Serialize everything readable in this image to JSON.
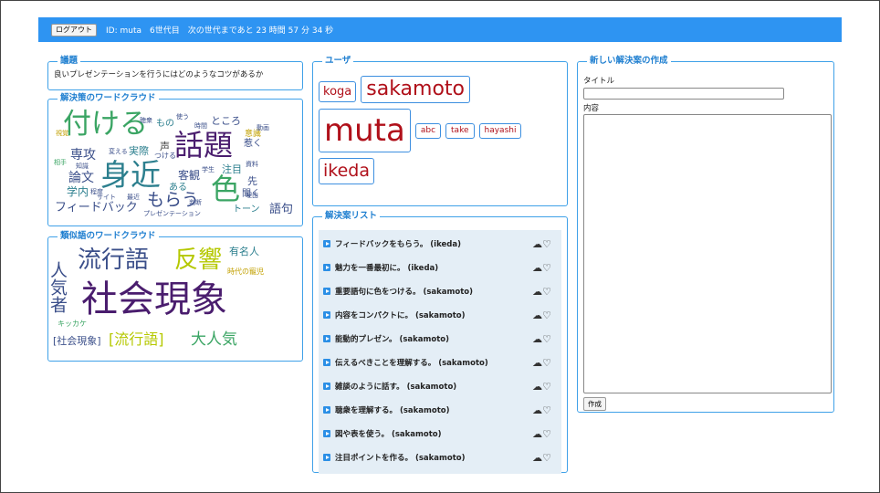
{
  "topbar": {
    "logout_label": "ログアウト",
    "info": "ID: muta　6世代目　次の世代まであと 23 時間 57 分 34 秒",
    "color": "#2e94f2"
  },
  "theme": {
    "legend": "議題",
    "text": "良いプレゼンテーションを行うにはどのようなコツがあるか"
  },
  "solution_cloud": {
    "legend": "解決策のワードクラウド",
    "words": [
      "付ける",
      "話題",
      "身近",
      "色",
      "もらう",
      "フィードバック",
      "専攻",
      "論文",
      "学内",
      "客観",
      "注目",
      "語句",
      "トーン",
      "先",
      "聞く",
      "声",
      "実際",
      "もの",
      "ところ",
      "惹く",
      "つける",
      "意識",
      "ある",
      "聴衆",
      "使う",
      "時間",
      "動画",
      "変える",
      "最近",
      "サイト",
      "プレゼンテーション",
      "判断",
      "資料",
      "理由",
      "学生",
      "程度",
      "知識",
      "視覚",
      "相手"
    ]
  },
  "similar_cloud": {
    "legend": "類似語のワードクラウド",
    "words": [
      "流行語",
      "反響",
      "有名人",
      "人気者",
      "時代の寵児",
      "社会現象",
      "キッカケ",
      "[社会現象]",
      "[流行語]",
      "大人気"
    ]
  },
  "users": {
    "legend": "ユーザ",
    "items": [
      "koga",
      "sakamoto",
      "muta",
      "abc",
      "take",
      "hayashi",
      "ikeda"
    ]
  },
  "solutions": {
    "legend": "解決案リスト",
    "icons": "☁♡",
    "items": [
      "フィードバックをもらう。 (ikeda)",
      "魅力を一番最初に。 (ikeda)",
      "重要語句に色をつける。 (sakamoto)",
      "内容をコンパクトに。 (sakamoto)",
      "能動的プレゼン。 (sakamoto)",
      "伝えるべきことを理解する。 (sakamoto)",
      "雑談のように話す。 (sakamoto)",
      "聴衆を理解する。 (sakamoto)",
      "図や表を使う。 (sakamoto)",
      "注目ポイントを作る。 (sakamoto)"
    ]
  },
  "new_solution": {
    "legend": "新しい解決案の作成",
    "title_label": "タイトル",
    "content_label": "内容",
    "create_label": "作成"
  }
}
